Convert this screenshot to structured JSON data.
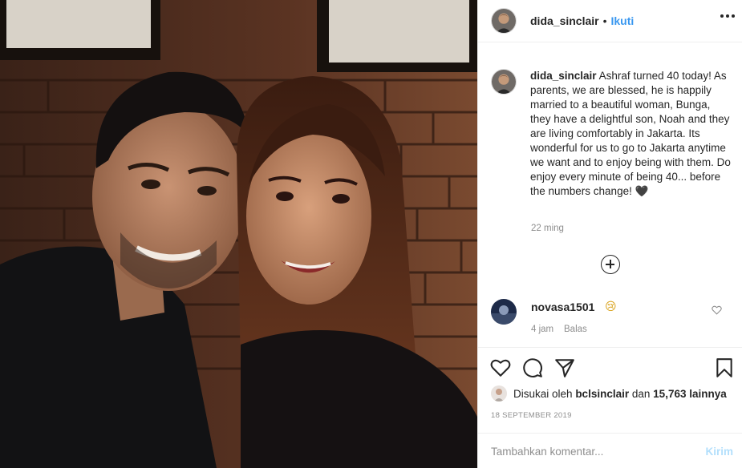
{
  "header": {
    "username": "dida_sinclair",
    "separator": "•",
    "follow_label": "Ikuti"
  },
  "caption": {
    "username": "dida_sinclair",
    "text": "Ashraf turned 40 today! As parents, we are blessed, he is happily married to a beautiful woman, Bunga, they have a delightful son, Noah and they are living comfortably in Jakarta. Its wonderful for us to go to Jakarta anytime we want and to enjoy being with them. Do enjoy every minute of being 40... before the numbers change! 🖤",
    "time": "22 ming"
  },
  "comments": [
    {
      "username": "novasa1501",
      "emoji": "😢",
      "time": "4 jam",
      "reply_label": "Balas"
    }
  ],
  "actions": {
    "like_icon": "heart-outline-icon",
    "comment_icon": "comment-bubble-icon",
    "share_icon": "paper-plane-icon",
    "save_icon": "bookmark-icon"
  },
  "likes": {
    "prefix": "Disukai oleh",
    "user": "bclsinclair",
    "conjunction": "dan",
    "count": "15,763",
    "suffix": "lainnya"
  },
  "date": "18 SEPTEMBER 2019",
  "comment_box": {
    "placeholder": "Tambahkan komentar...",
    "post_label": "Kirim"
  },
  "colors": {
    "link_blue": "#3897f0",
    "post_disabled": "#b2dffc",
    "secondary_text": "#8e8e8e",
    "divider": "#efefef"
  }
}
